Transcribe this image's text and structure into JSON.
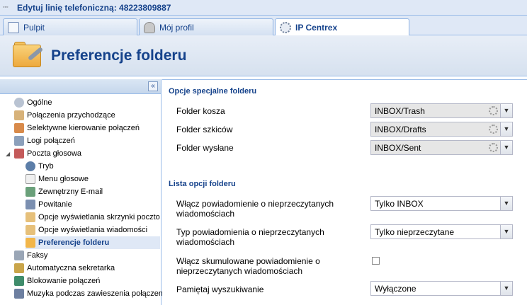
{
  "window": {
    "title": "Edytuj linię telefoniczną: 48223809887",
    "icon": "network-icon"
  },
  "tabs": [
    {
      "label": "Pulpit",
      "icon": "dashboard-icon",
      "active": false
    },
    {
      "label": "Mój profil",
      "icon": "user-icon",
      "active": false
    },
    {
      "label": "IP Centrex",
      "icon": "gear-icon",
      "active": true
    }
  ],
  "header": {
    "title": "Preferencje folderu",
    "icon": "folder-settings-icon"
  },
  "sidebar": {
    "items": [
      {
        "label": "Ogólne",
        "icon": "gear-icon"
      },
      {
        "label": "Połączenia przychodzące",
        "icon": "incoming-call-icon"
      },
      {
        "label": "Selektywne kierowanie połączeń",
        "icon": "routing-icon"
      },
      {
        "label": "Logi połączeń",
        "icon": "log-icon"
      },
      {
        "label": "Poczta głosowa",
        "icon": "voicemail-icon"
      },
      {
        "label": "Tryb",
        "icon": "mode-icon"
      },
      {
        "label": "Menu głosowe",
        "icon": "menu-icon"
      },
      {
        "label": "Zewnętrzny E-mail",
        "icon": "email-icon"
      },
      {
        "label": "Powitanie",
        "icon": "greeting-icon"
      },
      {
        "label": "Opcje wyświetlania skrzynki poczto",
        "icon": "mailbox-options-icon"
      },
      {
        "label": "Opcje wyświetlania wiadomości",
        "icon": "message-options-icon"
      },
      {
        "label": "Preferencje folderu",
        "icon": "folder-settings-icon"
      },
      {
        "label": "Faksy",
        "icon": "fax-icon"
      },
      {
        "label": "Automatyczna sekretarka",
        "icon": "answering-machine-icon"
      },
      {
        "label": "Blokowanie połączeń",
        "icon": "block-icon"
      },
      {
        "label": "Muzyka podczas zawieszenia połączen",
        "icon": "music-icon"
      }
    ]
  },
  "special_folders": {
    "title": "Opcje specjalne folderu",
    "fields": [
      {
        "label": "Folder kosza",
        "value": "INBOX/Trash"
      },
      {
        "label": "Folder szkiców",
        "value": "INBOX/Drafts"
      },
      {
        "label": "Folder wysłane",
        "value": "INBOX/Sent"
      }
    ]
  },
  "folder_options": {
    "title": "Lista opcji folderu",
    "unread_notify": {
      "label": "Włącz powiadomienie o nieprzeczytanych wiadomościach",
      "value": "Tylko INBOX"
    },
    "notify_type": {
      "label": "Typ powiadomienia o nieprzeczytanych wiadomościach",
      "value": "Tylko nieprzeczytane"
    },
    "cumulative": {
      "label": "Włącz skumulowane powiadomienie o nieprzeczytanych wiadomościach",
      "checked": false
    },
    "remember_search": {
      "label": "Pamiętaj wyszukiwanie",
      "value": "Wyłączone"
    }
  },
  "colors": {
    "accent": "#15428b",
    "border": "#99bbe8",
    "panel": "#dfe8f6"
  }
}
